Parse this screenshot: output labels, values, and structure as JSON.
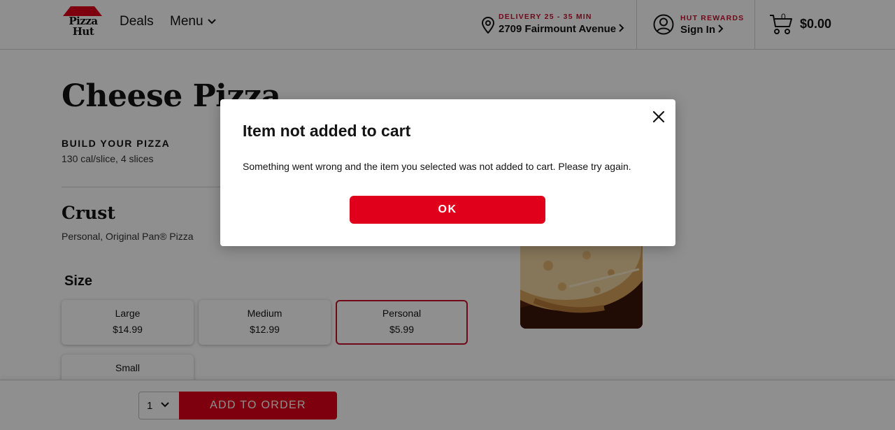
{
  "header": {
    "brand_line1": "Pizza",
    "brand_line2": "Hut",
    "nav": {
      "deals": "Deals",
      "menu": "Menu"
    },
    "delivery": {
      "label": "DELIVERY 25 - 35 MIN",
      "address": "2709 Fairmount Avenue"
    },
    "rewards": {
      "label": "HUT REWARDS",
      "sign_in": "Sign In"
    },
    "cart": {
      "count": "0",
      "total": "$0.00"
    }
  },
  "product": {
    "title": "Cheese Pizza",
    "build_label": "BUILD YOUR PIZZA",
    "calories": "130 cal/slice, 4 slices",
    "crust_heading": "Crust",
    "crust_value": "Personal, Original Pan® Pizza",
    "size_heading": "Size",
    "sizes": [
      {
        "name": "Large",
        "price": "$14.99",
        "selected": false
      },
      {
        "name": "Medium",
        "price": "$12.99",
        "selected": false
      },
      {
        "name": "Personal",
        "price": "$5.99",
        "selected": true
      },
      {
        "name": "Small",
        "price": "",
        "selected": false
      }
    ]
  },
  "order_bar": {
    "quantity": "1",
    "add_button": "ADD TO ORDER"
  },
  "modal": {
    "title": "Item not added to cart",
    "message": "Something went wrong and the item you selected was not added to cart. Please try again.",
    "ok_button": "OK"
  },
  "colors": {
    "accent_red": "#e0001b",
    "brand_red": "#c8102e",
    "text": "#131313"
  }
}
